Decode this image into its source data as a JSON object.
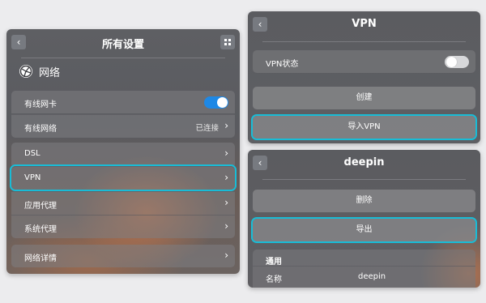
{
  "left_panel": {
    "title": "所有设置",
    "section_title": "网络",
    "wired_card_label": "有线网卡",
    "wired_card_on": true,
    "wired_net_label": "有线网络",
    "wired_net_status": "已连接",
    "dsl_label": "DSL",
    "vpn_label": "VPN",
    "app_proxy_label": "应用代理",
    "sys_proxy_label": "系统代理",
    "net_detail_label": "网络详情"
  },
  "vpn_panel": {
    "title": "VPN",
    "status_label": "VPN状态",
    "status_on": false,
    "create_label": "创建",
    "import_label": "导入VPN"
  },
  "deepin_panel": {
    "title": "deepin",
    "delete_label": "删除",
    "export_label": "导出",
    "general_header": "通用",
    "name_key": "名称",
    "name_value": "deepin"
  },
  "colors": {
    "highlight": "#19bcd6",
    "toggle_on": "#1e88e5"
  }
}
